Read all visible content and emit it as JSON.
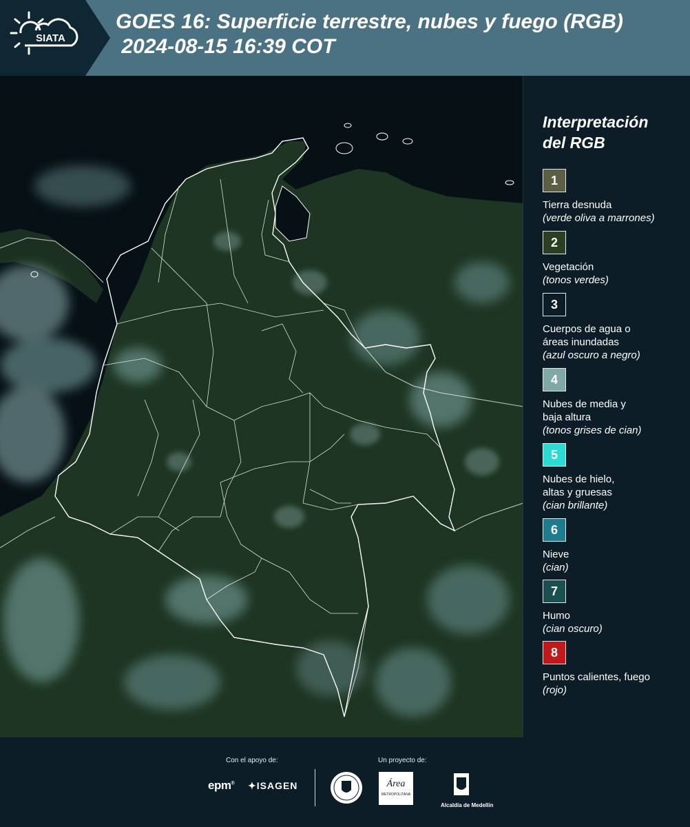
{
  "header": {
    "logo_text": "SIATA",
    "title": "GOES 16: Superficie terrestre, nubes y fuego (RGB)\n 2024-08-15 16:39 COT"
  },
  "map": {
    "land_color": "#1d3522",
    "water_color": "#061015",
    "cloud_color": "#7ea8a8",
    "border_color": "#ffffff"
  },
  "legend": {
    "title": "Interpretación\ndel RGB",
    "items": [
      {
        "num": "1",
        "label": "Tierra desnuda",
        "desc": "(verde oliva a marrones)",
        "color": "#5c5f43"
      },
      {
        "num": "2",
        "label": "Vegetación",
        "desc": "(tonos verdes)",
        "color": "#2b3f23"
      },
      {
        "num": "3",
        "label": "Cuerpos de agua o\náreas inundadas",
        "desc": "(azul oscuro a negro)",
        "color": "#0c1d27"
      },
      {
        "num": "4",
        "label": "Nubes de media y\nbaja altura",
        "desc": "(tonos grises de cian)",
        "color": "#7fa8a6"
      },
      {
        "num": "5",
        "label": "Nubes de hielo,\naltas y gruesas",
        "desc": "(cian brillante)",
        "color": "#2cdad4"
      },
      {
        "num": "6",
        "label": "Nieve",
        "desc": "(cian)",
        "color": "#1d7c8e"
      },
      {
        "num": "7",
        "label": "Humo",
        "desc": "(cian oscuro)",
        "color": "#1b4f50"
      },
      {
        "num": "8",
        "label": "Puntos calientes, fuego",
        "desc": "(rojo)",
        "color": "#c0191c"
      }
    ]
  },
  "footer": {
    "support_label": "Con el apoyo de:",
    "project_label": "Un proyecto de:",
    "epm": "epm",
    "isagen": "ISAGEN",
    "area_text": "Área",
    "area_sub": "METROPOLITANA",
    "alcaldia": "Alcaldía de Medellín"
  }
}
